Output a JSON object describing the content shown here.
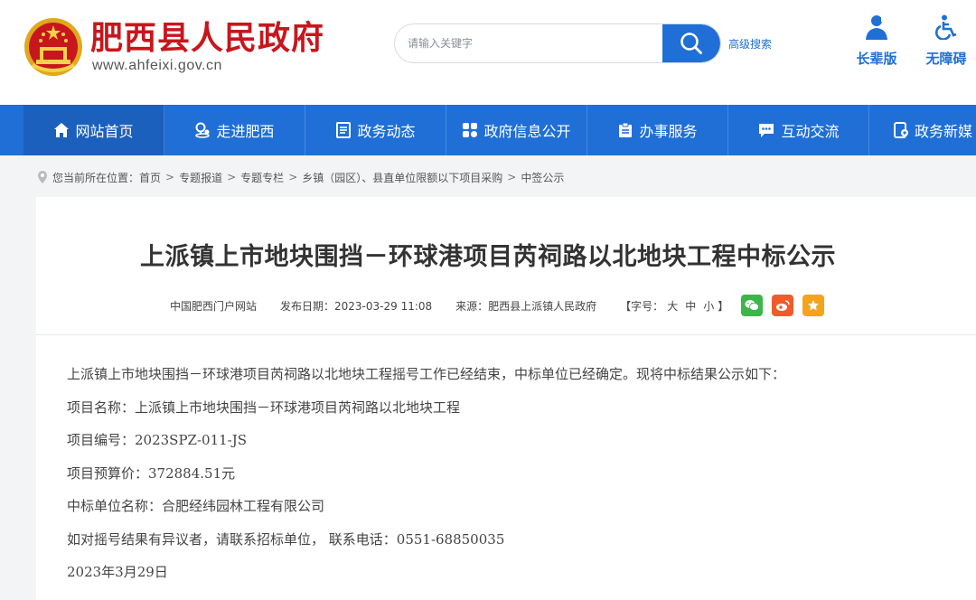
{
  "header": {
    "site_name": "肥西县人民政府",
    "domain": "www.ahfeixi.gov.cn",
    "search": {
      "placeholder": "请输入关键字",
      "advanced_label": "高级搜索"
    },
    "tools": [
      {
        "label": "长辈版",
        "icon": "elder-icon"
      },
      {
        "label": "无障碍",
        "icon": "wheelchair-icon"
      }
    ],
    "colors": {
      "brand_red": "#c8161d",
      "accent_blue": "#1f6fd6"
    }
  },
  "nav": {
    "items": [
      {
        "label": "网站首页",
        "icon": "home-icon"
      },
      {
        "label": "走进肥西",
        "icon": "location-icon"
      },
      {
        "label": "政务动态",
        "icon": "news-icon"
      },
      {
        "label": "政府信息公开",
        "icon": "info-open-icon"
      },
      {
        "label": "办事服务",
        "icon": "service-icon"
      },
      {
        "label": "互动交流",
        "icon": "chat-icon"
      },
      {
        "label": "政务新媒",
        "icon": "new-media-icon"
      }
    ]
  },
  "breadcrumb": {
    "prefix": "您当前所在位置：",
    "items": [
      "首页",
      "专题报道",
      "专题专栏",
      "乡镇（园区）、县直单位限额以下项目采购",
      "中签公示"
    ],
    "separator": ">"
  },
  "article": {
    "title": "上派镇上市地块围挡－环球港项目芮祠路以北地块工程中标公示",
    "meta": {
      "site": "中国肥西门户网站",
      "date": "发布日期：2023-03-29 11:08",
      "source": "来源：肥西县上派镇人民政府",
      "font_size_label": "【字号：",
      "font_size_options": [
        "大",
        "中",
        "小"
      ],
      "font_size_end": "】"
    },
    "share_icons": [
      "wechat-icon",
      "weibo-icon",
      "favorite-icon"
    ],
    "paragraphs": [
      "上派镇上市地块围挡－环球港项目芮祠路以北地块工程摇号工作已经结束，中标单位已经确定。现将中标结果公示如下：",
      "项目名称：上派镇上市地块围挡－环球港项目芮祠路以北地块工程",
      "项目编号：2023SPZ-011-JS",
      "项目预算价：372884.51元",
      "中标单位名称：合肥经纬园林工程有限公司",
      "如对摇号结果有异议者，请联系招标单位， 联系电话：0551-68850035",
      "2023年3月29日"
    ]
  }
}
